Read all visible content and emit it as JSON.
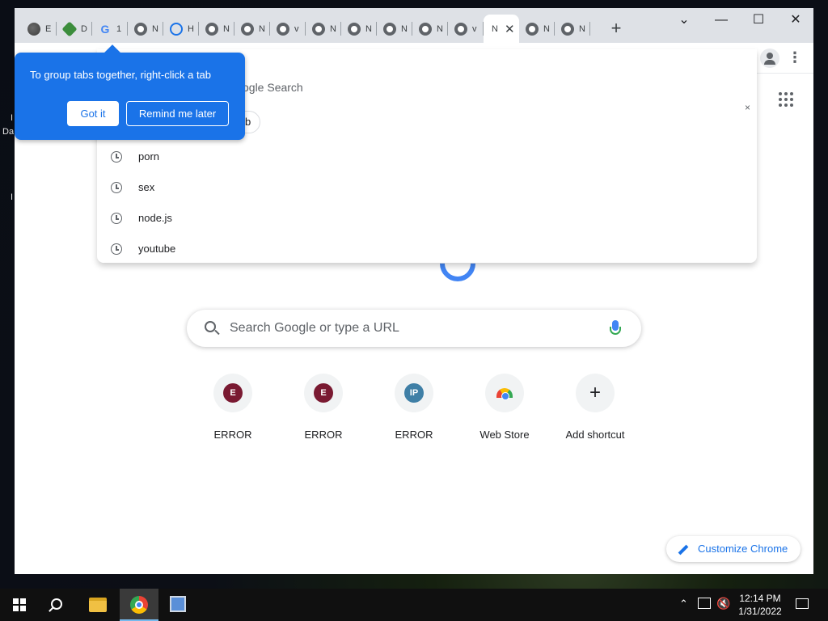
{
  "desktop": {
    "frag_top": "I",
    "frag_mid": "Da",
    "frag_bottom": "I"
  },
  "tabs": [
    {
      "icon": "globe-icon",
      "title": "E"
    },
    {
      "icon": "extension-icon",
      "title": "D"
    },
    {
      "icon": "google-icon",
      "title": "1"
    },
    {
      "icon": "chrome-icon",
      "title": "N"
    },
    {
      "icon": "history-icon",
      "title": "H"
    },
    {
      "icon": "chrome-icon",
      "title": "N"
    },
    {
      "icon": "chrome-icon",
      "title": "N"
    },
    {
      "icon": "chrome-icon",
      "title": "v"
    },
    {
      "icon": "chrome-icon",
      "title": "N"
    },
    {
      "icon": "chrome-icon",
      "title": "N"
    },
    {
      "icon": "chrome-icon",
      "title": "N"
    },
    {
      "icon": "chrome-icon",
      "title": "N"
    },
    {
      "icon": "chrome-icon",
      "title": "v"
    },
    {
      "icon": "chrome-icon",
      "title": "N",
      "active": true
    },
    {
      "icon": "chrome-icon",
      "title": "N"
    },
    {
      "icon": "chrome-icon",
      "title": "N"
    }
  ],
  "window_controls": {
    "collapse": "⌄",
    "minimize": "—",
    "maximize": "☐",
    "close": "✕"
  },
  "tab_group_bubble": {
    "text": "To group tabs together, right-click a tab",
    "got_it": "Got it",
    "remind_later": "Remind me later"
  },
  "omnibox_dropdown": {
    "top_text": "ogle Search",
    "chip_text": "b",
    "right_x": "×",
    "suggestions": [
      "porn",
      "sex",
      "node.js",
      "youtube"
    ]
  },
  "ntp": {
    "search_placeholder": "Search Google or type a URL",
    "shortcuts": [
      {
        "badge": "E",
        "badge_color": "#7a1a32",
        "label": "ERROR"
      },
      {
        "badge": "E",
        "badge_color": "#7a1a32",
        "label": "ERROR"
      },
      {
        "badge": "IP",
        "badge_color": "#3f7fa6",
        "label": "ERROR"
      },
      {
        "badge": "",
        "badge_color": "",
        "label": "Web Store"
      },
      {
        "badge": "+",
        "badge_color": "",
        "label": "Add shortcut"
      }
    ],
    "customize_label": "Customize Chrome"
  },
  "taskbar": {
    "time": "12:14 PM",
    "date": "1/31/2022"
  },
  "colors": {
    "accent": "#1a73e8",
    "tabstrip": "#dee1e6"
  }
}
